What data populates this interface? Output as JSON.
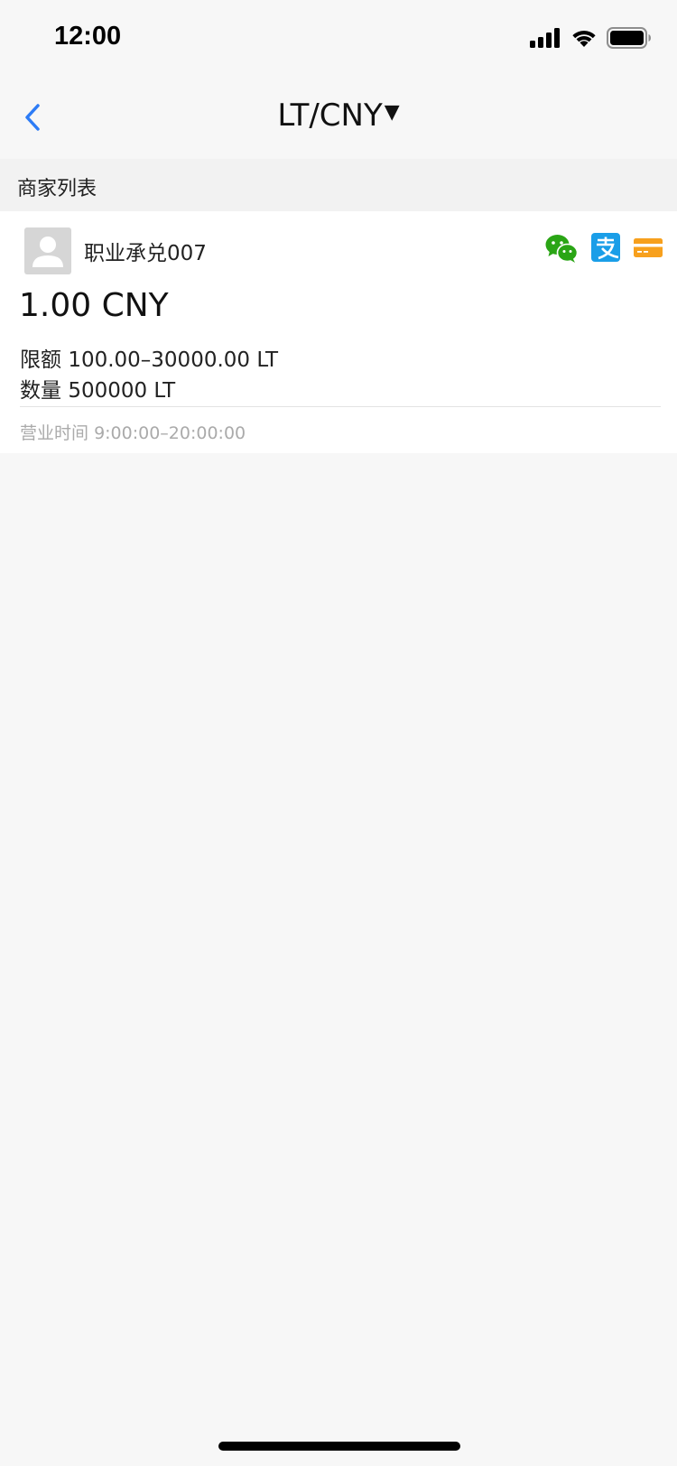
{
  "status_bar": {
    "time": "12:00",
    "icons": [
      "signal-icon",
      "wifi-icon",
      "battery-icon"
    ]
  },
  "nav": {
    "back_icon": "chevron-left-icon",
    "title": "LT/CNY",
    "title_caret": "▼"
  },
  "section": {
    "title": "商家列表"
  },
  "merchants": [
    {
      "name": "职业承兑007",
      "avatar_icon": "user-placeholder-icon",
      "payment_icons": [
        "wechat-pay-icon",
        "alipay-icon",
        "bank-card-icon"
      ],
      "price": "1.00 CNY",
      "limit_label": "限额",
      "limit_value": "100.00–30000.00 LT",
      "quantity_label": "数量",
      "quantity_value": "500000 LT",
      "hours_label": "营业时间",
      "hours_value": "9:00:00–20:00:00"
    }
  ],
  "colors": {
    "accent": "#2d7cf6",
    "wechat": "#2aa515",
    "alipay": "#1a9ee8",
    "card": "#f7a01d",
    "background": "#f7f7f7"
  }
}
